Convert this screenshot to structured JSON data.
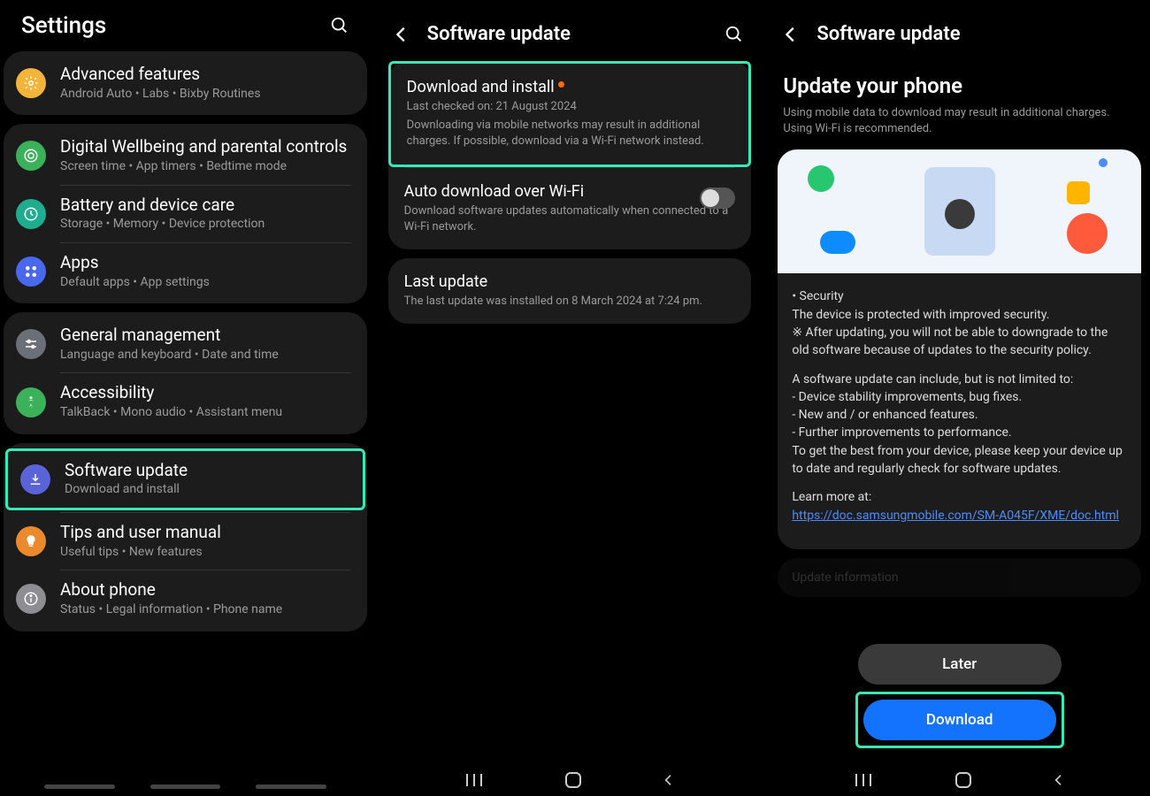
{
  "panel1": {
    "title": "Settings",
    "groups": [
      [
        {
          "title": "Advanced features",
          "sub": "Android Auto • Labs • Bixby Routines",
          "iconColor": "#f3b43a",
          "icon": "gear"
        }
      ],
      [
        {
          "title": "Digital Wellbeing and parental controls",
          "sub": "Screen time • App timers • Bedtime mode",
          "iconColor": "#3bb25a",
          "icon": "wellbeing"
        },
        {
          "title": "Battery and device care",
          "sub": "Storage • Memory • Device protection",
          "iconColor": "#1eae8f",
          "icon": "battery"
        },
        {
          "title": "Apps",
          "sub": "Default apps • App settings",
          "iconColor": "#4a68ed",
          "icon": "apps"
        }
      ],
      [
        {
          "title": "General management",
          "sub": "Language and keyboard • Date and time",
          "iconColor": "#6a6f78",
          "icon": "sliders"
        },
        {
          "title": "Accessibility",
          "sub": "TalkBack • Mono audio • Assistant menu",
          "iconColor": "#3bb25a",
          "icon": "accessibility"
        }
      ],
      [
        {
          "title": "Software update",
          "sub": "Download and install",
          "iconColor": "#5b63d8",
          "icon": "download",
          "highlight": true
        },
        {
          "title": "Tips and user manual",
          "sub": "Useful tips • New features",
          "iconColor": "#eb8a2d",
          "icon": "bulb"
        },
        {
          "title": "About phone",
          "sub": "Status • Legal information • Phone name",
          "iconColor": "#8d8d92",
          "icon": "info"
        }
      ]
    ]
  },
  "panel2": {
    "header": "Software update",
    "items": [
      {
        "title": "Download and install",
        "subLines": [
          "Last checked on: 21 August 2024",
          "Downloading via mobile networks may result in additional charges. If possible, download via a Wi-Fi network instead."
        ],
        "highlight": true,
        "hasBadge": true
      },
      {
        "title": "Auto download over Wi-Fi",
        "subLines": [
          "Download software updates automatically when connected to a Wi-Fi network."
        ],
        "toggle": true
      }
    ],
    "lastUpdate": {
      "title": "Last update",
      "sub": "The last update was installed on 8 March 2024 at 7:24 pm."
    }
  },
  "panel3": {
    "header": "Software update",
    "bigTitle": "Update your phone",
    "desc": "Using mobile data to download may result in additional charges. Using Wi-Fi is recommended.",
    "securityTitle": "• Security",
    "securityLine1": "The device is protected with improved security.",
    "securityLine2": "※ After updating, you will not be able to downgrade to the old software because of updates to the security policy.",
    "includeIntro": "A software update can include, but is not limited to:",
    "includes": [
      " - Device stability improvements, bug fixes.",
      " - New and / or enhanced features.",
      " - Further improvements to performance."
    ],
    "bestText": "To get the best from your device, please keep your device up to date and regularly check for software updates.",
    "learnMore": "Learn more at:",
    "link": "https://doc.samsungmobile.com/SM-A045F/XME/doc.html",
    "nextCard": "Update information",
    "laterBtn": "Later",
    "downloadBtn": "Download"
  }
}
